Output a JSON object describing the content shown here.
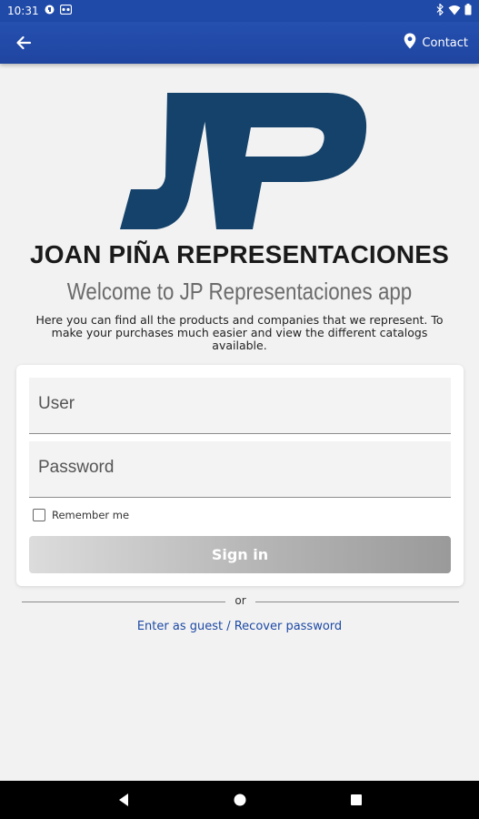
{
  "status_bar": {
    "time": "10:31",
    "icons": [
      "app-icon",
      "app-icon-2",
      "bluetooth-icon",
      "wifi-icon",
      "battery-icon"
    ]
  },
  "app_bar": {
    "back_icon": "back-arrow-icon",
    "contact_label": "Contact",
    "contact_icon": "location-pin-icon"
  },
  "logo": {
    "text": "JP",
    "color": "#14426b"
  },
  "brand_title": "JOAN PIÑA REPRESENTACIONES",
  "welcome": "Welcome to JP Representaciones app",
  "description": "Here you can find all the products and companies that we represent. To make your purchases much easier and view the different catalogs available.",
  "login_form": {
    "user_placeholder": "User",
    "password_placeholder": "Password",
    "remember_label": "Remember me",
    "remember_checked": false,
    "signin_label": "Sign in"
  },
  "divider_text": "or",
  "guest_link": "Enter as guest / Recover password",
  "nav": {
    "icons": [
      "back-triangle-icon",
      "home-circle-icon",
      "recents-square-icon"
    ]
  },
  "colors": {
    "primary": "#1f4aa8",
    "link": "#1d4aa5",
    "logo": "#14426b"
  }
}
